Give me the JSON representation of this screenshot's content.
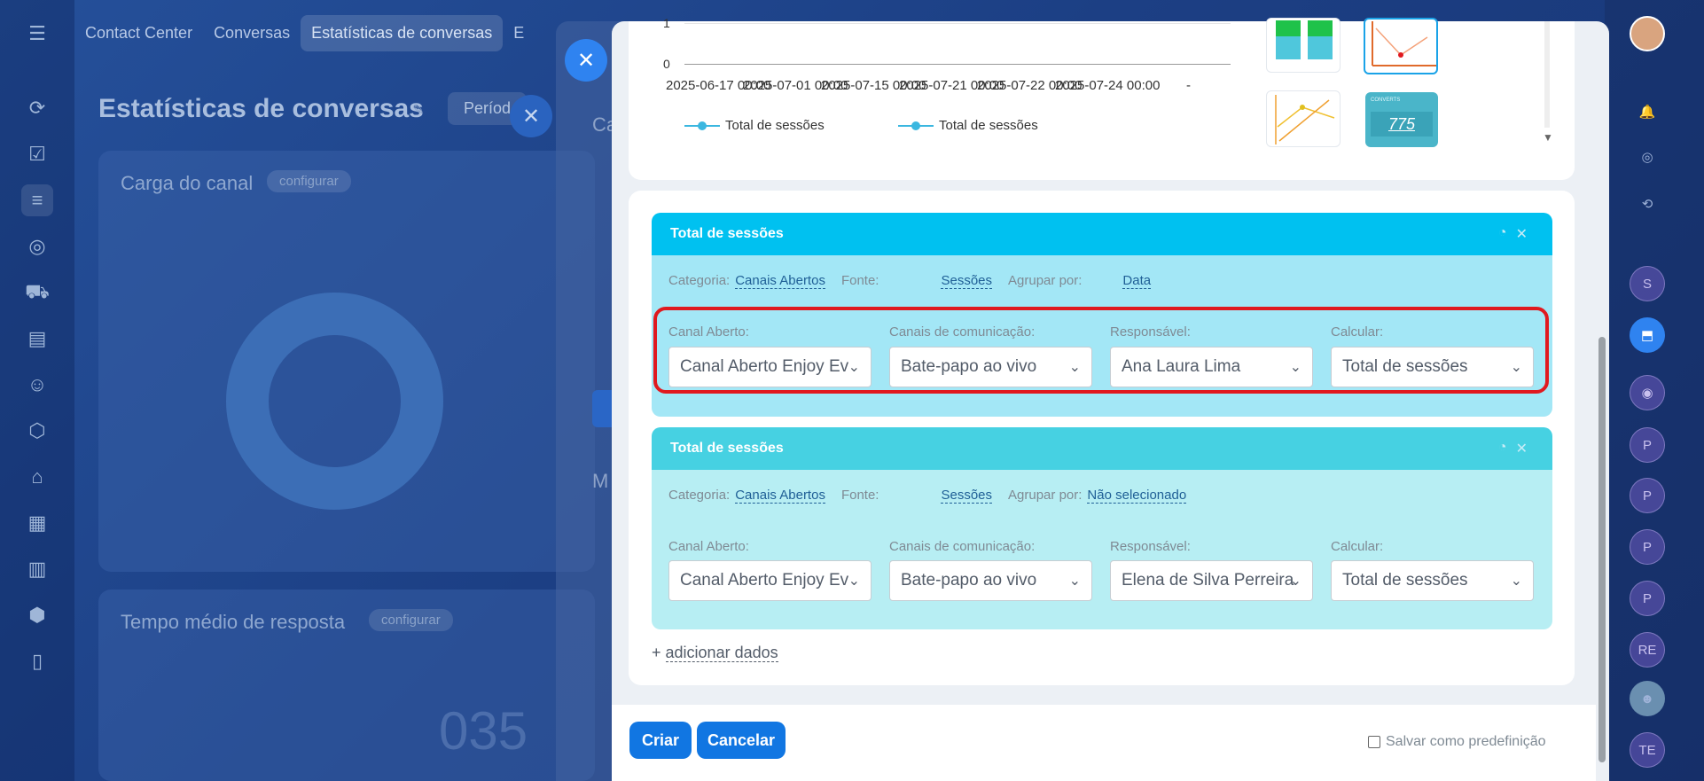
{
  "top_nav": {
    "tabs": [
      {
        "label": "Contact Center"
      },
      {
        "label": "Conversas"
      },
      {
        "label": "Estatísticas de conversas"
      },
      {
        "label": "E"
      }
    ]
  },
  "page": {
    "title": "Estatísticas de conversas",
    "period_label": "Períod"
  },
  "widgets": {
    "carga": {
      "title": "Carga do canal",
      "config": "configurar"
    },
    "tempo": {
      "title": "Tempo médio de resposta",
      "config": "configurar"
    },
    "bg_number": "035"
  },
  "mid_layer": {
    "text1": "Ca",
    "text2": "M"
  },
  "chart_data": {
    "type": "line",
    "y_ticks": [
      "1",
      "0"
    ],
    "x_ticks": [
      "2025-06-17 00:00",
      "2025-07-01 00:00",
      "2025-07-15 00:00",
      "2025-07-21 00:00",
      "2025-07-22 00:00",
      "2025-07-24 00:00",
      "-"
    ],
    "series": [
      {
        "name": "Total de sessões",
        "color": "#3bb7e0"
      },
      {
        "name": "Total de sessões",
        "color": "#3bb7e0"
      }
    ]
  },
  "thumbnails": {
    "counter_value": "775",
    "counter_label": "CONVERTS"
  },
  "datasets": [
    {
      "title": "Total de sessões",
      "header_color": "#00c1f0",
      "body_color": "#a3e7f6",
      "categoria_label": "Categoria:",
      "categoria": "Canais Abertos",
      "fonte_label": "Fonte:",
      "fonte": "Sessões",
      "agrupar_label": "Agrupar por:",
      "agrupar": "Data",
      "fields": {
        "canal_label": "Canal Aberto:",
        "canal": "Canal Aberto Enjoy Ev",
        "canais_label": "Canais de comunicação:",
        "canais": "Bate-papo ao vivo",
        "responsavel_label": "Responsável:",
        "responsavel": "Ana Laura Lima",
        "calcular_label": "Calcular:",
        "calcular": "Total de sessões"
      }
    },
    {
      "title": "Total de sessões",
      "header_color": "#46d1e2",
      "body_color": "#b7eef3",
      "categoria_label": "Categoria:",
      "categoria": "Canais Abertos",
      "fonte_label": "Fonte:",
      "fonte": "Sessões",
      "agrupar_label": "Agrupar por:",
      "agrupar": "Não selecionado",
      "fields": {
        "canal_label": "Canal Aberto:",
        "canal": "Canal Aberto Enjoy Ev",
        "canais_label": "Canais de comunicação:",
        "canais": "Bate-papo ao vivo",
        "responsavel_label": "Responsável:",
        "responsavel": "Elena de Silva Perreira",
        "calcular_label": "Calcular:",
        "calcular": "Total de sessões"
      }
    }
  ],
  "add_data": {
    "prefix": "+",
    "label": "adicionar dados"
  },
  "footer": {
    "create_label": "Criar",
    "cancel_label": "Cancelar",
    "save_preset_label": "Salvar como predefinição"
  },
  "right_bar": {
    "letters": [
      "S",
      "P",
      "P",
      "P",
      "P",
      "RE",
      "TE"
    ]
  }
}
